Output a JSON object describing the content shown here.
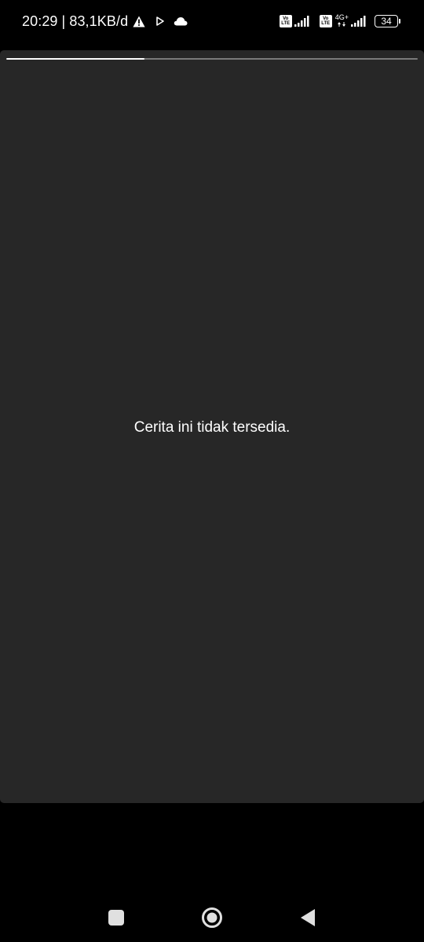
{
  "status_bar": {
    "time": "20:29",
    "separator": "|",
    "network_speed": "83,1KB/d",
    "notification_icons": [
      "warning-icon",
      "play-icon",
      "cloud-icon"
    ],
    "sim1_volte_top": "Vo",
    "sim1_volte_bottom": "LTE",
    "sim2_volte_top": "Vo",
    "sim2_volte_bottom": "LTE",
    "network_type": "4G+",
    "battery_level": "34"
  },
  "story": {
    "progress": 0.335,
    "message": "Cerita ini tidak tersedia."
  },
  "colors": {
    "background": "#000000",
    "panel": "#272727",
    "progress_fill": "#ffffff",
    "progress_track": "#7a7a7a",
    "text": "#ffffff",
    "nav_icon": "#e0e0e0"
  },
  "navigation": {
    "buttons": [
      "recent-apps-icon",
      "home-icon",
      "back-icon"
    ]
  }
}
